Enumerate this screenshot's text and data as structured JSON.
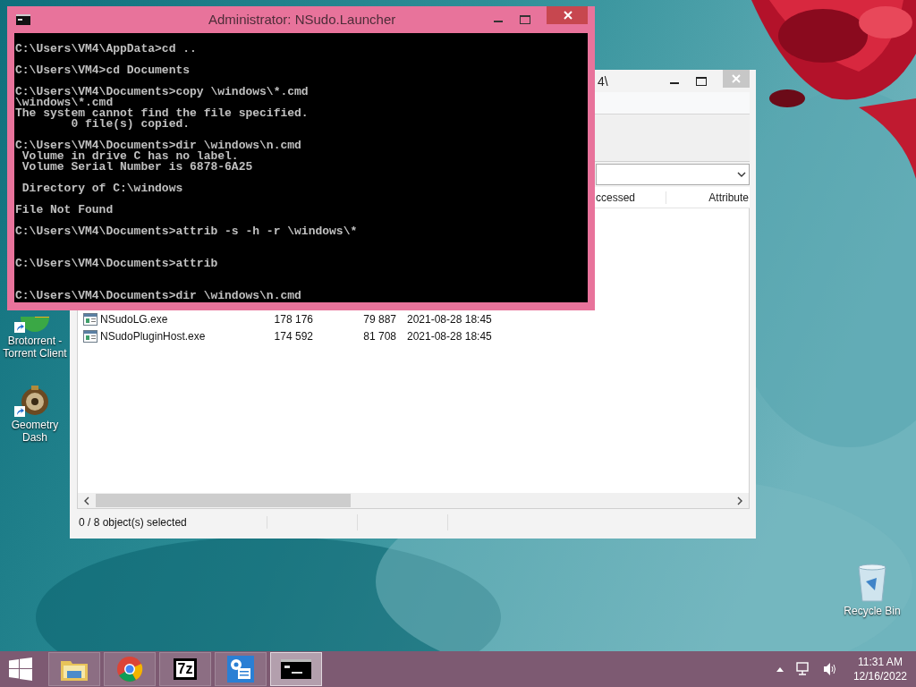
{
  "desktop": {
    "icons": [
      {
        "kind": "torrent",
        "label": "Brotorrent - Torrent Client",
        "shortcut": true
      },
      {
        "kind": "game",
        "label": "Geometry Dash",
        "shortcut": true
      },
      {
        "kind": "recycle",
        "label": "Recycle Bin",
        "shortcut": false
      }
    ]
  },
  "file_manager": {
    "title": "4\\",
    "columns": [
      "ccessed",
      "Attribute"
    ],
    "rows": [
      {
        "name": "NSudoLG.exe",
        "size": "178 176",
        "packed": "79 887",
        "modified": "2021-08-28 18:45"
      },
      {
        "name": "NSudoPluginHost.exe",
        "size": "174 592",
        "packed": "81 708",
        "modified": "2021-08-28 18:45"
      }
    ],
    "status": "0 / 8 object(s) selected"
  },
  "console_window": {
    "title": "Administrator: NSudo.Launcher",
    "text": "C:\\Users\\VM4\\AppData>cd ..\n\nC:\\Users\\VM4>cd Documents\n\nC:\\Users\\VM4\\Documents>copy \\windows\\*.cmd\n\\windows\\*.cmd\nThe system cannot find the file specified.\n        0 file(s) copied.\n\nC:\\Users\\VM4\\Documents>dir \\windows\\n.cmd\n Volume in drive C has no label.\n Volume Serial Number is 6878-6A25\n\n Directory of C:\\windows\n\nFile Not Found\n\nC:\\Users\\VM4\\Documents>attrib -s -h -r \\windows\\*\n\n\nC:\\Users\\VM4\\Documents>attrib\n\n\nC:\\Users\\VM4\\Documents>dir \\windows\\n.cmd"
  },
  "taskbar": {
    "apps": [
      {
        "kind": "folder",
        "selected": false
      },
      {
        "kind": "browser",
        "selected": false
      },
      {
        "kind": "archiver",
        "label": "7z",
        "selected": false
      },
      {
        "kind": "settings",
        "selected": false
      },
      {
        "kind": "console",
        "selected": true
      }
    ],
    "clock": {
      "time": "11:31 AM",
      "date": "12/16/2022"
    }
  }
}
